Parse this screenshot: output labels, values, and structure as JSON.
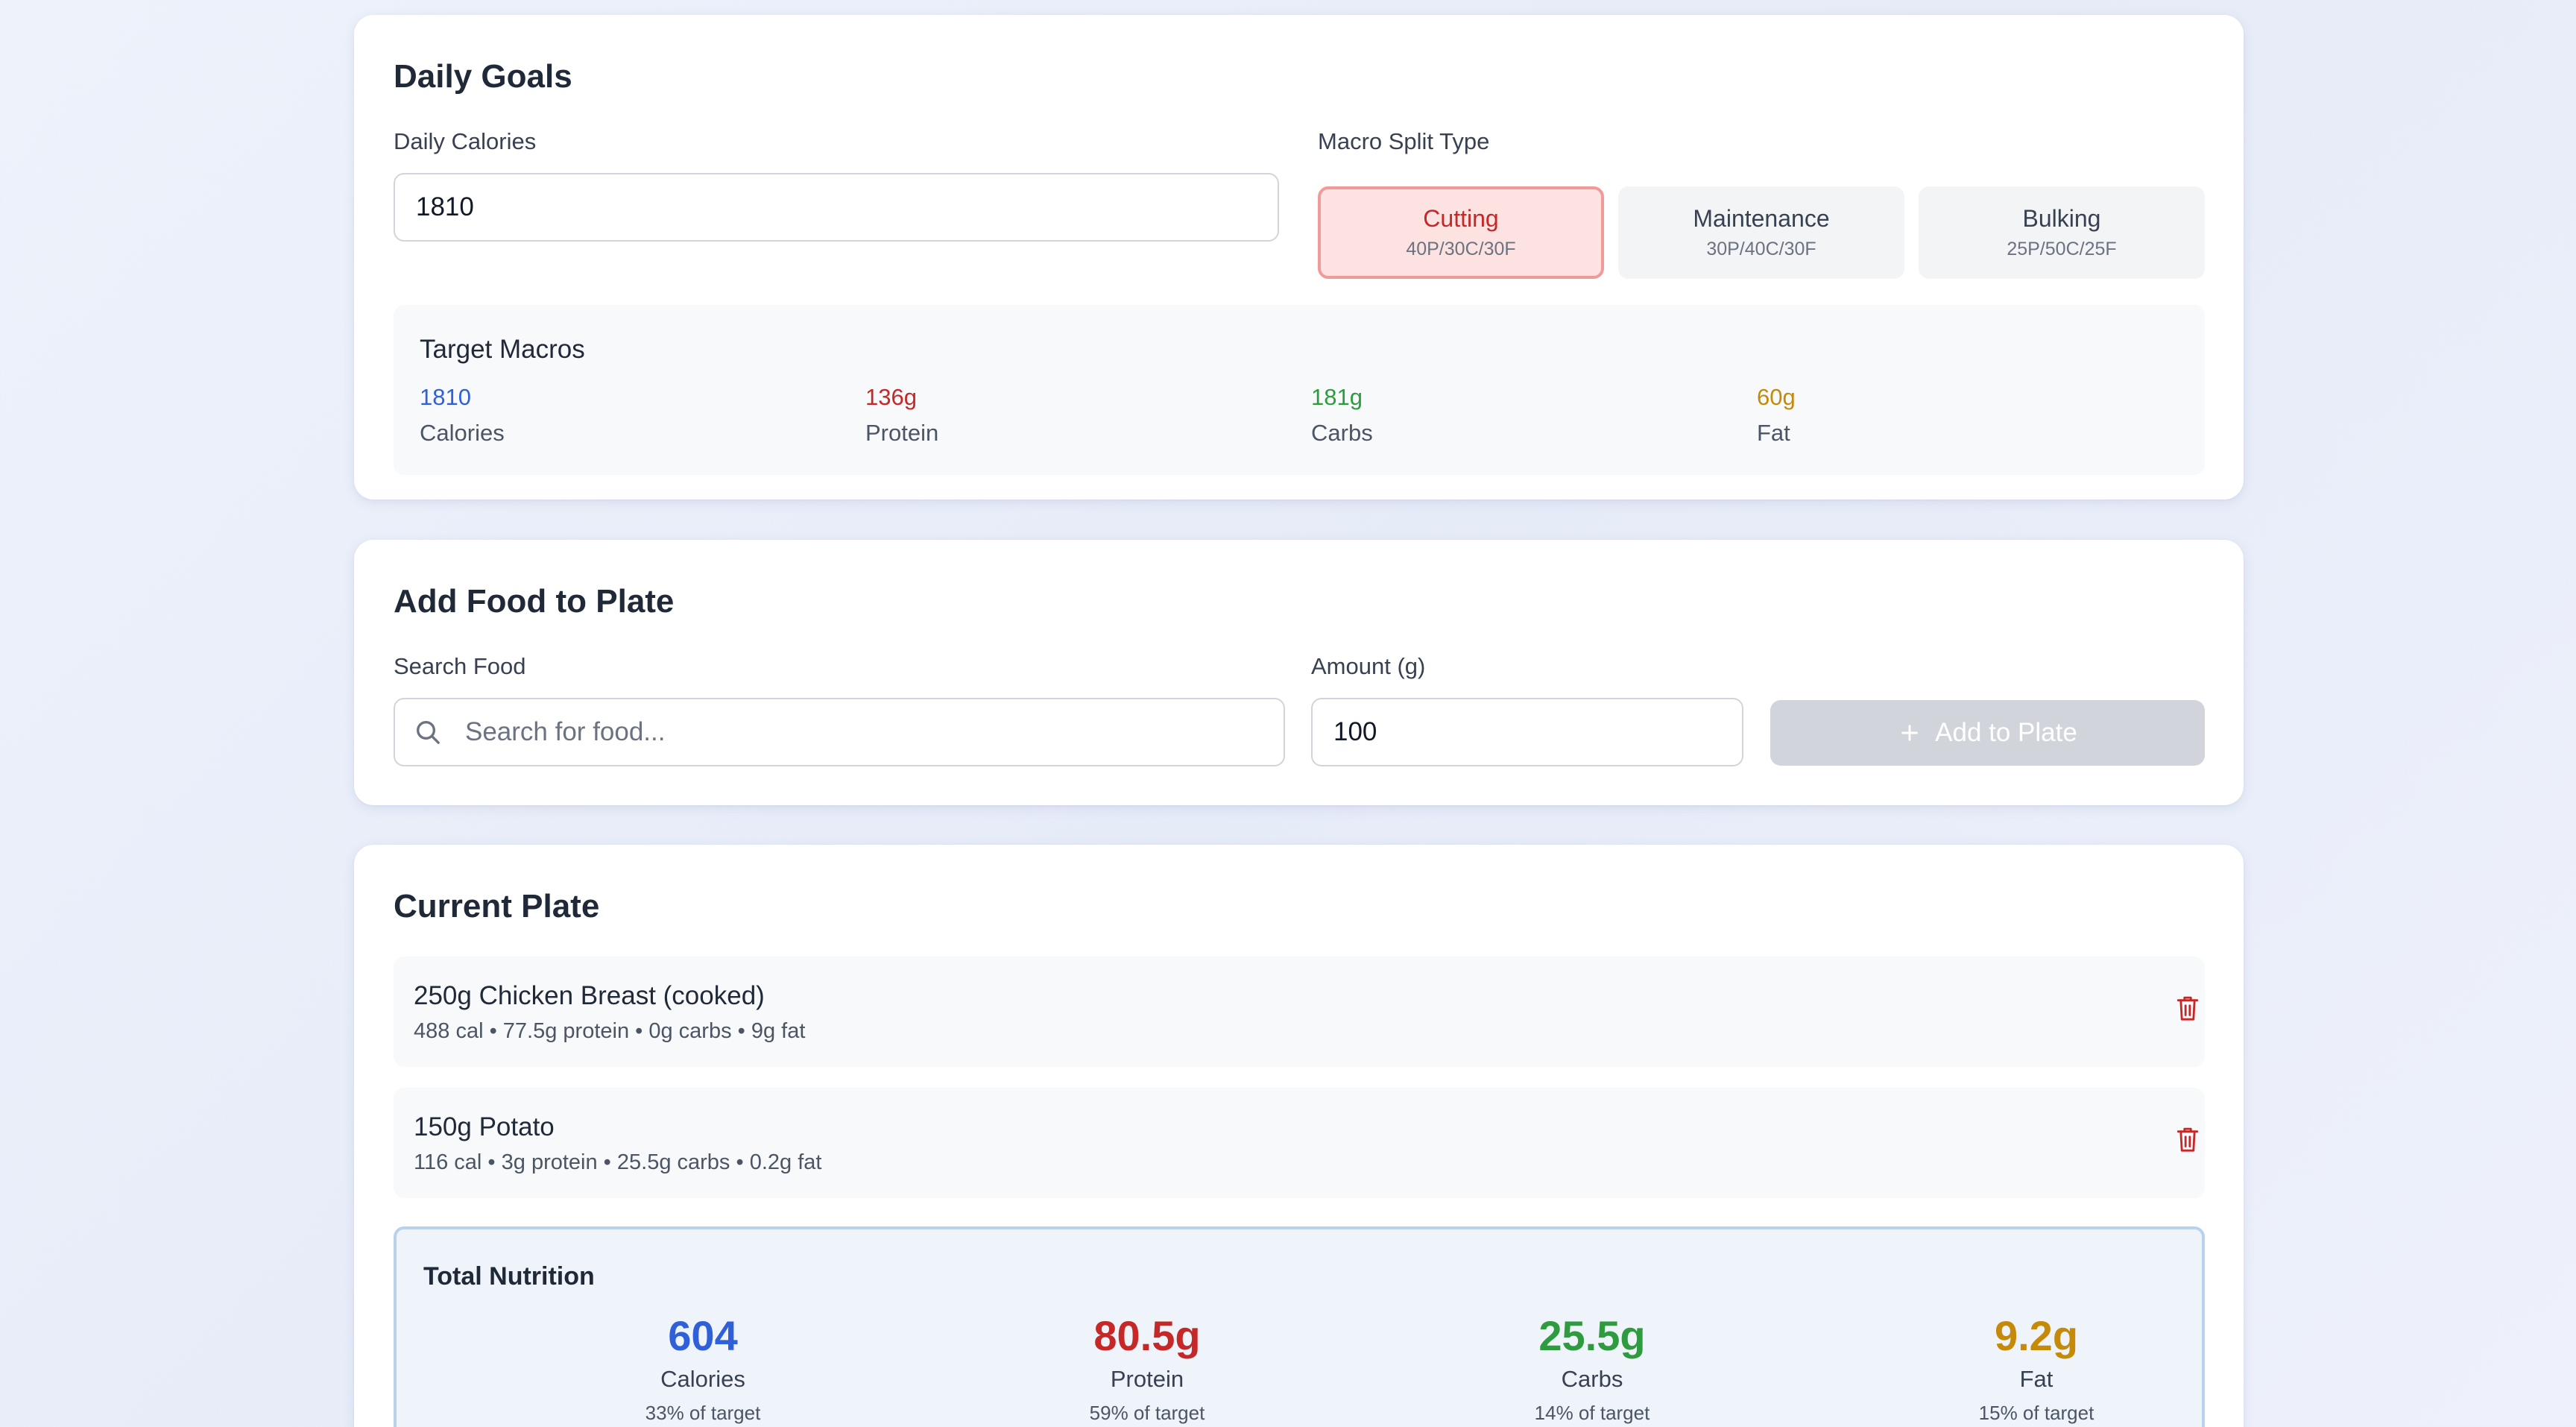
{
  "colors": {
    "calories": "#2f5fd9",
    "protein": "#c62828",
    "carbs": "#2e9b3f",
    "fat": "#c58a07"
  },
  "daily_goals": {
    "title": "Daily Goals",
    "calories_label": "Daily Calories",
    "calories_value": "1810",
    "split_label": "Macro Split Type",
    "splits": [
      {
        "name": "Cutting",
        "ratio": "40P/30C/30F",
        "selected": true
      },
      {
        "name": "Maintenance",
        "ratio": "30P/40C/30F",
        "selected": false
      },
      {
        "name": "Bulking",
        "ratio": "25P/50C/25F",
        "selected": false
      }
    ],
    "target": {
      "title": "Target Macros",
      "items": [
        {
          "value": "1810",
          "label": "Calories"
        },
        {
          "value": "136g",
          "label": "Protein"
        },
        {
          "value": "181g",
          "label": "Carbs"
        },
        {
          "value": "60g",
          "label": "Fat"
        }
      ]
    }
  },
  "add_food": {
    "title": "Add Food to Plate",
    "search_label": "Search Food",
    "search_placeholder": "Search for food...",
    "search_icon": "search-icon",
    "amount_label": "Amount (g)",
    "amount_value": "100",
    "add_button_label": "Add to Plate",
    "add_button_icon": "plus-icon"
  },
  "plate": {
    "title": "Current Plate",
    "items": [
      {
        "title": "250g Chicken Breast (cooked)",
        "detail": "488 cal • 77.5g protein • 0g carbs • 9g fat",
        "icon": "trash-icon"
      },
      {
        "title": "150g Potato",
        "detail": "116 cal • 3g protein • 25.5g carbs • 0.2g fat",
        "icon": "trash-icon"
      }
    ],
    "total": {
      "title": "Total Nutrition",
      "items": [
        {
          "value": "604",
          "label": "Calories",
          "pct": "33% of target"
        },
        {
          "value": "80.5g",
          "label": "Protein",
          "pct": "59% of target"
        },
        {
          "value": "25.5g",
          "label": "Carbs",
          "pct": "14% of target"
        },
        {
          "value": "9.2g",
          "label": "Fat",
          "pct": "15% of target"
        }
      ]
    }
  }
}
